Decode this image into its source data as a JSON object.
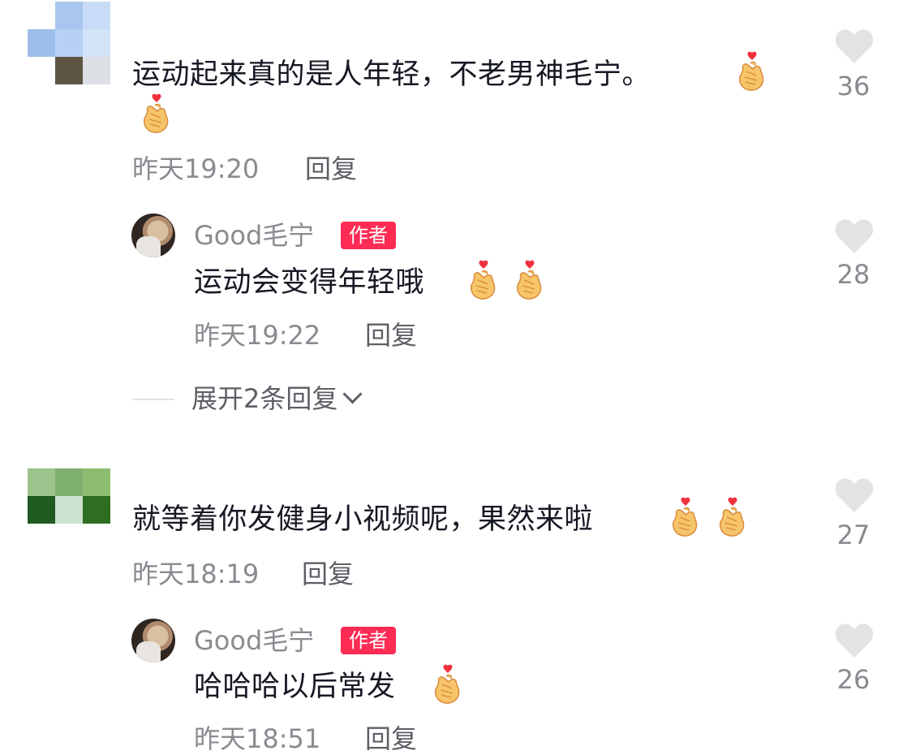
{
  "comments": [
    {
      "text": "运动起来真的是人年轻，不老男神毛宁。",
      "time": "昨天19:20",
      "reply": "回复",
      "likes": "36",
      "avatar_colors": [
        "#ffffff",
        "#a9c6f0",
        "#c9dcf7",
        "#9ebfe9",
        "#b7d1f5",
        "#d3e3f8",
        "#ffffff",
        "#5f5545",
        "#dcdfe3"
      ]
    },
    {
      "text": "就等着你发健身小视频呢，果然来啦",
      "time": "昨天18:19",
      "reply": "回复",
      "likes": "27",
      "avatar_colors": [
        "#9cc48c",
        "#7fb06f",
        "#8dbd70",
        "#1f5a1f",
        "#cde2d0",
        "#2e6e22"
      ]
    }
  ],
  "replies": [
    {
      "user": "Good毛宁",
      "badge": "作者",
      "text": "运动会变得年轻哦",
      "time": "昨天19:22",
      "reply": "回复",
      "likes": "28"
    },
    {
      "user": "Good毛宁",
      "badge": "作者",
      "text": "哈哈哈以后常发",
      "time": "昨天18:51",
      "reply": "回复",
      "likes": "26"
    }
  ],
  "expand_text": "展开2条回复",
  "colors": {
    "badge": "#fe2c55",
    "heart": "#e3e3e4",
    "meta": "#8a8b91"
  }
}
